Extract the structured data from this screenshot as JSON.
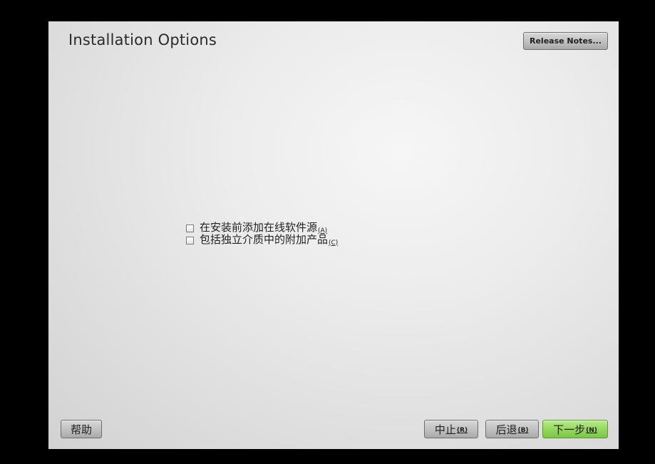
{
  "window": {
    "title": "Installation Options"
  },
  "header": {
    "release_notes_label": "Release Notes..."
  },
  "options": [
    {
      "label": "在安装前添加在线软件源",
      "hotkey": "(A)",
      "checked": false
    },
    {
      "label": "包括独立介质中的附加产品",
      "hotkey": "(C)",
      "checked": false
    }
  ],
  "footer": {
    "help_label": "帮助",
    "abort_label": "中止",
    "abort_hotkey": "(R)",
    "back_label": "后退",
    "back_hotkey": "(B)",
    "next_label": "下一步",
    "next_hotkey": "(N)"
  },
  "colors": {
    "background": "#000000",
    "panel": "#e8e8e8",
    "next_button": "#96d860"
  }
}
